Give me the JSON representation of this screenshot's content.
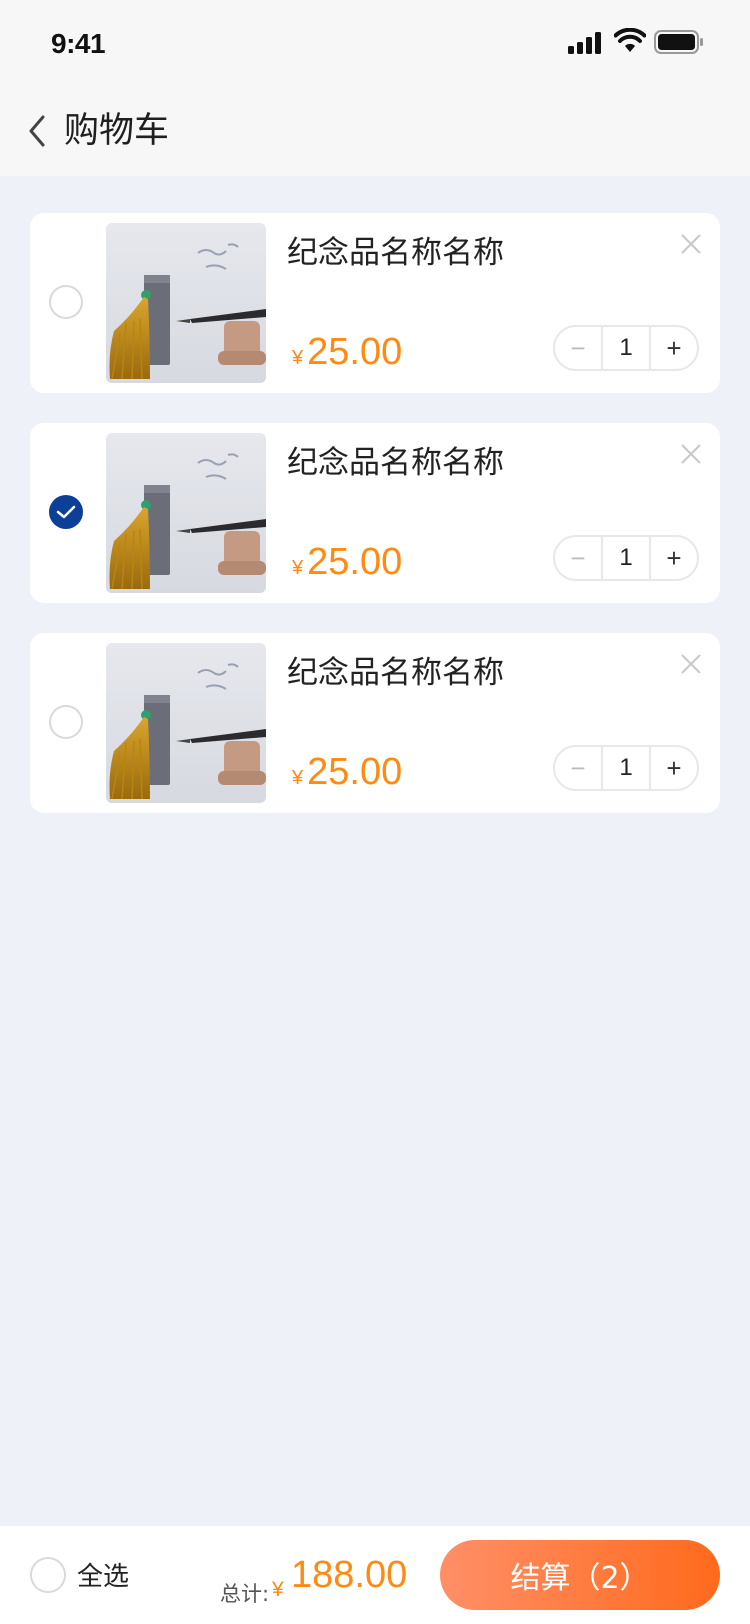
{
  "status_bar": {
    "time": "9:41"
  },
  "nav": {
    "title": "购物车"
  },
  "items": [
    {
      "name": "纪念品名称名称",
      "currency": "¥",
      "price": "25.00",
      "quantity": "1",
      "checked": false,
      "minus": "−",
      "plus": "+"
    },
    {
      "name": "纪念品名称名称",
      "currency": "¥",
      "price": "25.00",
      "quantity": "1",
      "checked": true,
      "minus": "−",
      "plus": "+"
    },
    {
      "name": "纪念品名称名称",
      "currency": "¥",
      "price": "25.00",
      "quantity": "1",
      "checked": false,
      "minus": "−",
      "plus": "+"
    }
  ],
  "footer": {
    "select_all_label": "全选",
    "total_label": "总计:",
    "total_currency": "¥",
    "total_value": "188.00",
    "checkout_label": "结算（2）"
  },
  "colors": {
    "accent_orange": "#ff8a12",
    "checked_blue": "#0c3f97",
    "checkout_gradient_start": "#ff8f67",
    "checkout_gradient_end": "#ff6a1c"
  },
  "icons": {
    "back": "chevron-left-icon",
    "remove": "close-icon",
    "checked": "check-icon"
  }
}
